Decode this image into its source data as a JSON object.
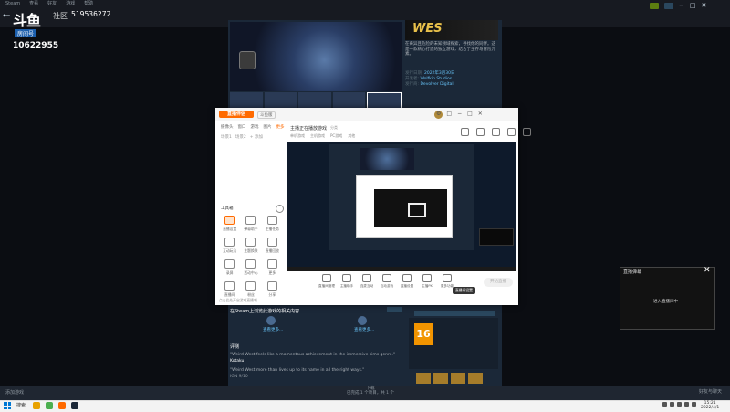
{
  "steam": {
    "menu": [
      "Steam",
      "查看",
      "好友",
      "游戏",
      "帮助"
    ],
    "community_label": "社区",
    "room_number": "519536272",
    "window_controls": [
      "−",
      "□",
      "✕"
    ],
    "store": {
      "capsule_title": "WES",
      "description": "在奇异且危险的未知领域探索，寻找你的同伴。这是一款精心打造的独立游戏，结合了生存与冒险元素。",
      "meta": [
        {
          "label": "发行日期:",
          "value": "2022年3月30日"
        },
        {
          "label": "开发者:",
          "value": "Wolfkin Studios"
        },
        {
          "label": "发行商:",
          "value": "Devolver Digital"
        }
      ],
      "review_header": "在Steam上浏览此游戏的相关内容",
      "review_btn": "",
      "link_a": "查看更多...",
      "link_b": "查看更多...",
      "review_title": "评测",
      "quote1": "\"Weird West feels like a momentous achievement in the immersive sims genre.\"",
      "quote1_src": "Kotaku",
      "quote2": "\"Weird West more than lives up to its name in all the right ways.\"",
      "quote2_src": "IGN 9/10",
      "age_rating": "16"
    },
    "bottom_left": "添加游戏",
    "bottom_center": [
      "下载",
      "已完成 1 个项目，共 1 个"
    ],
    "bottom_right": "好友与聊天"
  },
  "douyu": {
    "logo_text": "斗鱼",
    "room_label": "房间号",
    "room_id": "10622955"
  },
  "live_window": {
    "logo": "直播伴侣",
    "version": "斗鱼版",
    "controls": [
      "⚙",
      "□",
      "−",
      "□",
      "✕"
    ],
    "tabs": [
      "摄像头",
      "窗口",
      "游戏",
      "图片",
      "更多"
    ],
    "active_tab": "更多",
    "scene_row": [
      "场景1",
      "场景2",
      "+ 添加"
    ],
    "tools_title": "工具箱",
    "tools": [
      {
        "label": "直播设置",
        "orange": true
      },
      {
        "label": "弹幕助手",
        "orange": false
      },
      {
        "label": "主播任务",
        "orange": false
      },
      {
        "label": "互动玩法",
        "orange": false
      },
      {
        "label": "主题换肤",
        "orange": false
      },
      {
        "label": "直播回放",
        "orange": false
      },
      {
        "label": "录屏",
        "orange": false
      },
      {
        "label": "活动中心",
        "orange": false
      },
      {
        "label": "更多",
        "orange": false
      },
      {
        "label": "直播间",
        "orange": false
      },
      {
        "label": "粉丝",
        "orange": false
      },
      {
        "label": "分享",
        "orange": false
      }
    ],
    "notice": "点击此处开启游戏直播吧",
    "room_title": "主播正在播放游戏",
    "room_tag": "分类",
    "room_meta": [
      "单机游戏",
      "主机游戏",
      "PC游戏",
      "其他"
    ],
    "toolbar": [
      {
        "label": "直播间管理"
      },
      {
        "label": "主播助手"
      },
      {
        "label": "连麦互动"
      },
      {
        "label": "互动游戏"
      },
      {
        "label": "直播设置"
      },
      {
        "label": "主播PK"
      },
      {
        "label": "更多功能"
      }
    ],
    "tooltip": "直播间设置",
    "start_btn": "开始直播"
  },
  "chat_overlay": {
    "header": "直播弹幕",
    "body": "进入直播间中"
  },
  "taskbar": {
    "search": "搜索",
    "clock": [
      "15:21",
      "2022/4/1"
    ]
  }
}
